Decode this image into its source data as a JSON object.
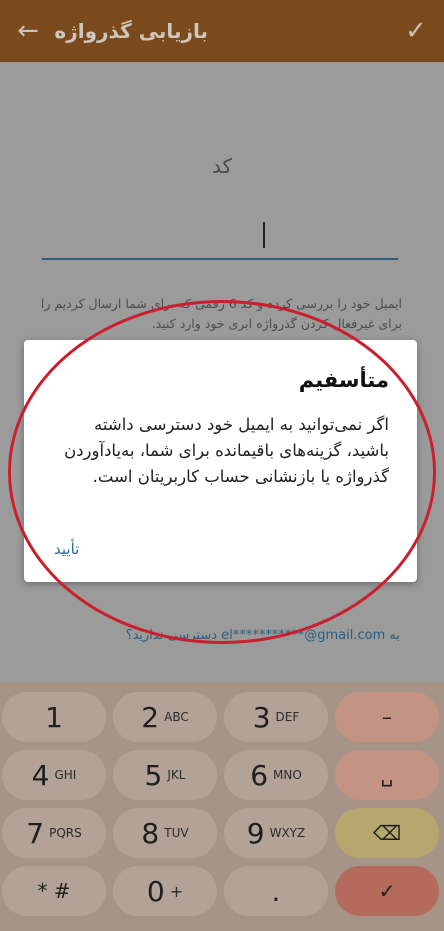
{
  "appbar": {
    "title": "بازیابی گذرواژه",
    "back_icon": "←",
    "confirm_icon": "✓"
  },
  "form": {
    "code_label": "کد",
    "instructions": "ایمیل خود را بررسی کرده و کد 6 رقمی که برای شما ارسال کردیم را برای غیرفعال کردن گذرواژه ابری خود وارد کنید.",
    "email_link": "به el***********@gmail.com دسترسی ندارید؟"
  },
  "dialog": {
    "title": "متأسفیم",
    "body": "اگر نمی‌توانید به ایمیل خود دسترسی داشته باشید، گزینه‌های باقیمانده برای شما، به‌یادآوردن گذرواژه یا بازنشانی حساب کاربریتان است.",
    "ok_label": "تأیید"
  },
  "keypad": {
    "keys": [
      {
        "num": "1",
        "letters": ""
      },
      {
        "num": "2",
        "letters": "ABC"
      },
      {
        "num": "3",
        "letters": "DEF"
      },
      {
        "num": "4",
        "letters": "GHI"
      },
      {
        "num": "5",
        "letters": "JKL"
      },
      {
        "num": "6",
        "letters": "MNO"
      },
      {
        "num": "7",
        "letters": "PQRS"
      },
      {
        "num": "8",
        "letters": "TUV"
      },
      {
        "num": "9",
        "letters": "WXYZ"
      },
      {
        "num": "* #",
        "letters": ""
      },
      {
        "num": "0",
        "letters": "+"
      },
      {
        "num": ".",
        "letters": ""
      }
    ],
    "minus": "–",
    "space": "␣",
    "backspace": "⌫",
    "done": "✓"
  }
}
